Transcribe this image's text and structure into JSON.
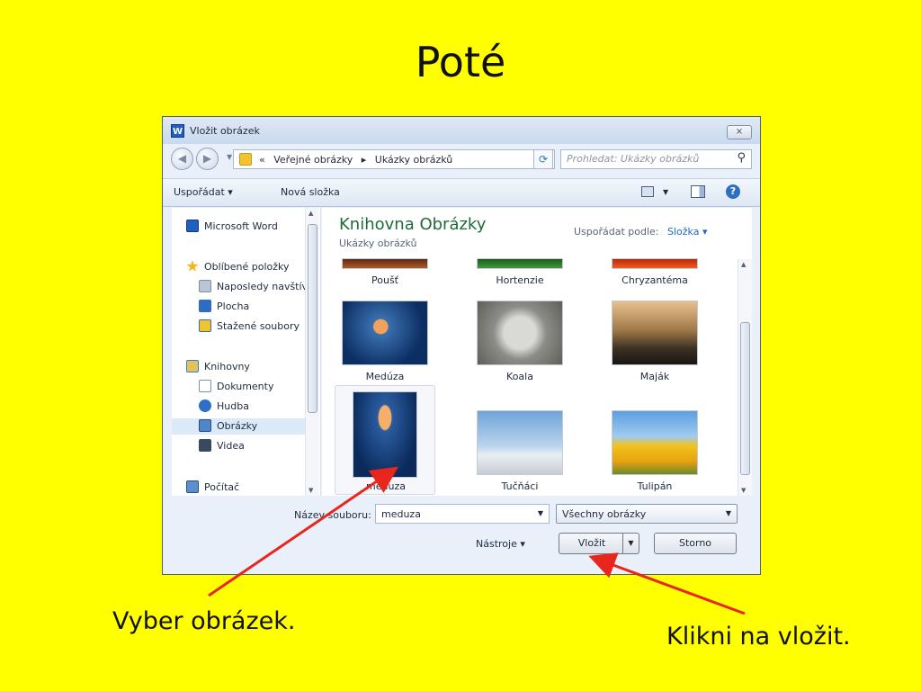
{
  "slide": {
    "title": "Poté",
    "annotation_left": "Vyber obrázek.",
    "annotation_right": "Klikni na vložit."
  },
  "dialog": {
    "app_icon_text": "W",
    "title": "Vložit obrázek",
    "close_label": "⨯",
    "address": {
      "prefix": "«",
      "crumbs": [
        "Veřejné obrázky",
        "Ukázky obrázků"
      ],
      "separator": "▸"
    },
    "search_placeholder": "Prohledat: Ukázky obrázků",
    "toolbar": {
      "organize": "Uspořádat ▾",
      "new_folder": "Nová složka"
    },
    "nav": {
      "word": "Microsoft Word",
      "favorites": "Oblíbené položky",
      "recent": "Naposledy navštívená místa",
      "desktop": "Plocha",
      "downloads": "Stažené soubory",
      "libraries": "Knihovny",
      "documents": "Dokumenty",
      "music": "Hudba",
      "pictures": "Obrázky",
      "videos": "Videa",
      "computer": "Počítač"
    },
    "library": {
      "title": "Knihovna Obrázky",
      "subtitle": "Ukázky obrázků",
      "arrange_label": "Uspořádat podle:",
      "arrange_value": "Složka ▾"
    },
    "thumbnails": [
      {
        "name": "Poušť"
      },
      {
        "name": "Hortenzie"
      },
      {
        "name": "Chryzantéma"
      },
      {
        "name": "Medúza"
      },
      {
        "name": "Koala"
      },
      {
        "name": "Maják"
      },
      {
        "name": "meduza"
      },
      {
        "name": "Tučňáci"
      },
      {
        "name": "Tulipán"
      }
    ],
    "bottom": {
      "filename_label": "Název souboru:",
      "filename_value": "meduza",
      "filetype": "Všechny obrázky",
      "tools": "Nástroje ▾",
      "insert": "Vložit",
      "cancel": "Storno"
    }
  },
  "colors": {
    "background": "#ffff00",
    "arrow": "#e8261e",
    "library_title": "#1e6b3a",
    "link": "#1a6ac8"
  }
}
